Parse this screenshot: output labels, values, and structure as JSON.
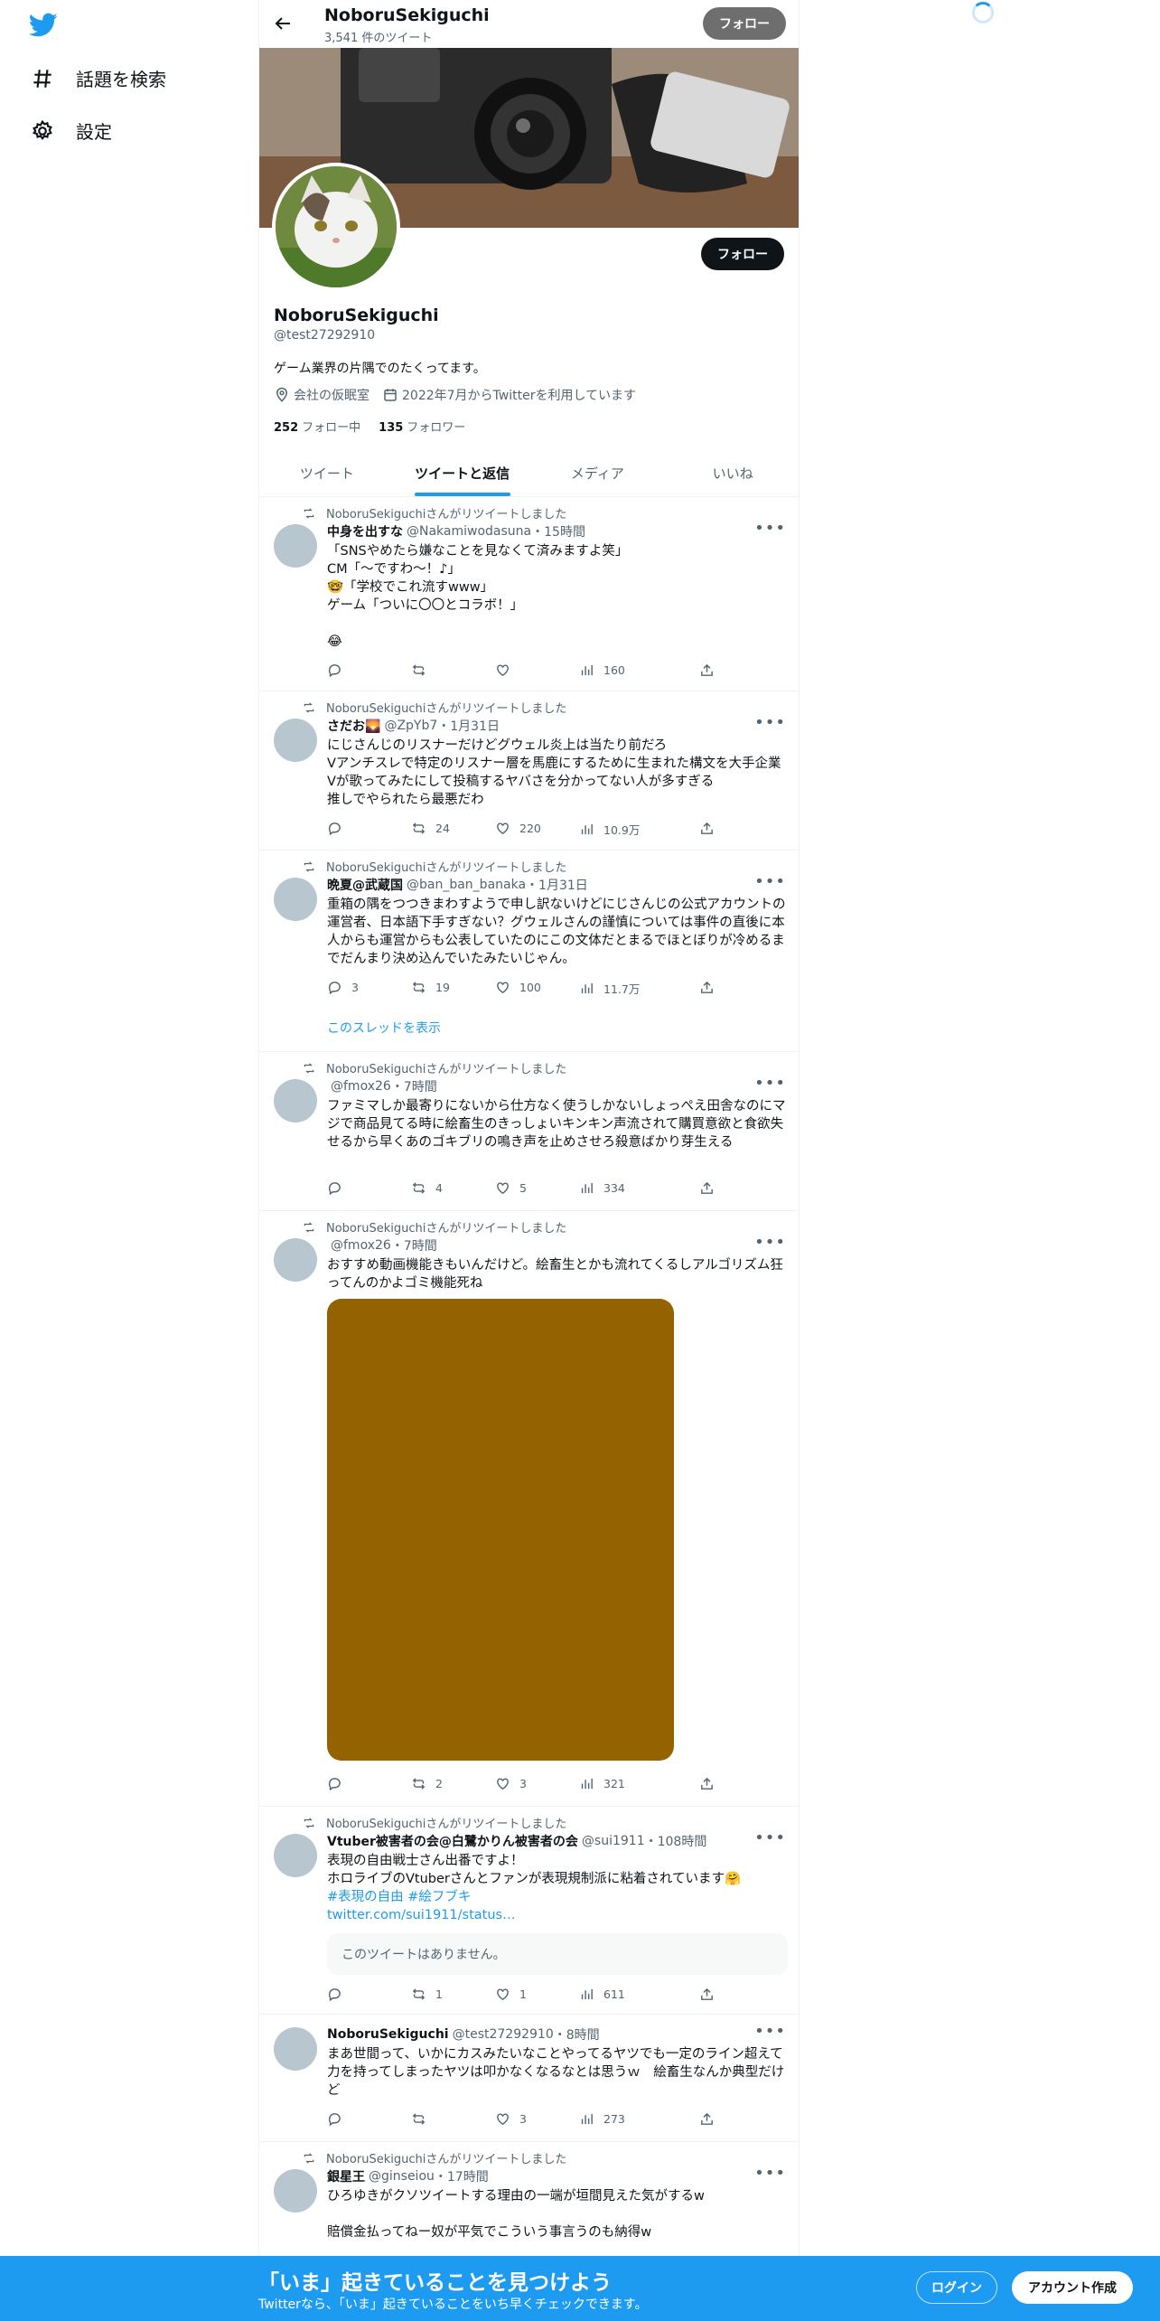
{
  "nav": {
    "explore": "話題を検索",
    "settings": "設定"
  },
  "topbar": {
    "name": "NoboruSekiguchi",
    "tweet_count": "3,541 件のツイート",
    "follow": "フォロー"
  },
  "profile": {
    "follow": "フォロー",
    "name": "NoboruSekiguchi",
    "handle": "@test27292910",
    "bio": "ゲーム業界の片隅でのたくってます。",
    "location": "会社の仮眠室",
    "joined": "2022年7月からTwitterを利用しています",
    "following_count": "252",
    "following_label": "フォロー中",
    "followers_count": "135",
    "followers_label": "フォロワー"
  },
  "tabs": [
    "ツイート",
    "ツイートと返信",
    "メディア",
    "いいね"
  ],
  "tweets": [
    {
      "rt": "NoboruSekiguchiさんがリツイートしました",
      "name": "中身を出すな",
      "handle": "@Nakamiwodasuna",
      "time": "・15時間",
      "text": "「SNSやめたら嫌なことを見なくて済みますよ笑」\nCM「〜ですわ〜！♪」\n🤓「学校でこれ流すwww」\nゲーム「ついに〇〇とコラボ！」\n\n😂",
      "reply": "",
      "retweet": "",
      "like": "",
      "views": "160"
    },
    {
      "rt": "NoboruSekiguchiさんがリツイートしました",
      "name": "さだお🌄",
      "handle": "@ZpYb7",
      "time": "・1月31日",
      "text": "にじさんじのリスナーだけどグウェル炎上は当たり前だろ\nVアンチスレで特定のリスナー層を馬鹿にするために生まれた構文を大手企業Vが歌ってみたにして投稿するヤバさを分かってない人が多すぎる\n推しでやられたら最悪だわ",
      "reply": "",
      "retweet": "24",
      "like": "220",
      "views": "10.9万"
    },
    {
      "rt": "NoboruSekiguchiさんがリツイートしました",
      "name": "晩夏@武蔵国",
      "handle": "@ban_ban_banaka",
      "time": "・1月31日",
      "text": "重箱の隅をつつきまわすようで申し訳ないけどにじさんじの公式アカウントの運営者、日本語下手すぎない？グウェルさんの謹慎については事件の直後に本人からも運営からも公表していたのにこの文体だとまるでほとぼりが冷めるまでだんまり決め込んでいたみたいじゃん。",
      "reply": "3",
      "retweet": "19",
      "like": "100",
      "views": "11.7万",
      "thread": "このスレッドを表示"
    },
    {
      "rt": "NoboruSekiguchiさんがリツイートしました",
      "name": "",
      "handle": "@fmox26",
      "time": "・7時間",
      "text": "ファミマしか最寄りにないから仕方なく使うしかないしょっぺえ田舎なのにマジで商品見てる時に絵畜生のきっしょいキンキン声流されて購買意欲と食欲失せるから早くあのゴキブリの鳴き声を止めさせろ殺意ばかり芽生える",
      "reply": "",
      "retweet": "4",
      "like": "5",
      "views": "334"
    },
    {
      "rt": "NoboruSekiguchiさんがリツイートしました",
      "name": "",
      "handle": "@fmox26",
      "time": "・7時間",
      "text": "おすすめ動画機能きもいんだけど。絵畜生とかも流れてくるしアルゴリズム狂ってんのかよゴミ機能死ね",
      "reply": "",
      "retweet": "2",
      "like": "3",
      "views": "321",
      "media_color": "#946300"
    },
    {
      "rt": "NoboruSekiguchiさんがリツイートしました",
      "name": "Vtuber被害者の会@白鷺かりん被害者の会",
      "handle": "@sui1911",
      "time": "・108時間",
      "text": "表現の自由戦士さん出番ですよ！\nホロライブのVtuberさんとファンが表現規制派に粘着されています🤗",
      "hashtags": "#表現の自由 #絵フブキ",
      "link": "twitter.com/sui1911/status…",
      "quote": "このツイートはありません。",
      "reply": "",
      "retweet": "1",
      "like": "1",
      "views": "611"
    },
    {
      "rt": "",
      "name": "NoboruSekiguchi",
      "handle": "@test27292910",
      "time": "・8時間",
      "text": "まあ世間って、いかにカスみたいなことやってるヤツでも一定のライン超えて力を持ってしまったヤツは叩かなくなるなとは思うｗ　絵畜生なんか典型だけど",
      "reply": "",
      "retweet": "",
      "like": "3",
      "views": "273"
    },
    {
      "rt": "NoboruSekiguchiさんがリツイートしました",
      "name": "銀星王",
      "handle": "@ginseiou",
      "time": "・17時間",
      "text": "ひろゆきがクソツイートする理由の一端が垣間見えた気がするw\n\n賠償金払ってねー奴が平気でこういう事言うのも納得w"
    }
  ],
  "bottom": {
    "title": "「いま」起きていることを見つけよう",
    "subtitle": "Twitterなら、「いま」起きていることをいち早くチェックできます。",
    "login": "ログイン",
    "signup": "アカウント作成"
  },
  "colors": {
    "accent": "#1d9bf0",
    "text": "#0f1419",
    "muted": "#536471"
  }
}
